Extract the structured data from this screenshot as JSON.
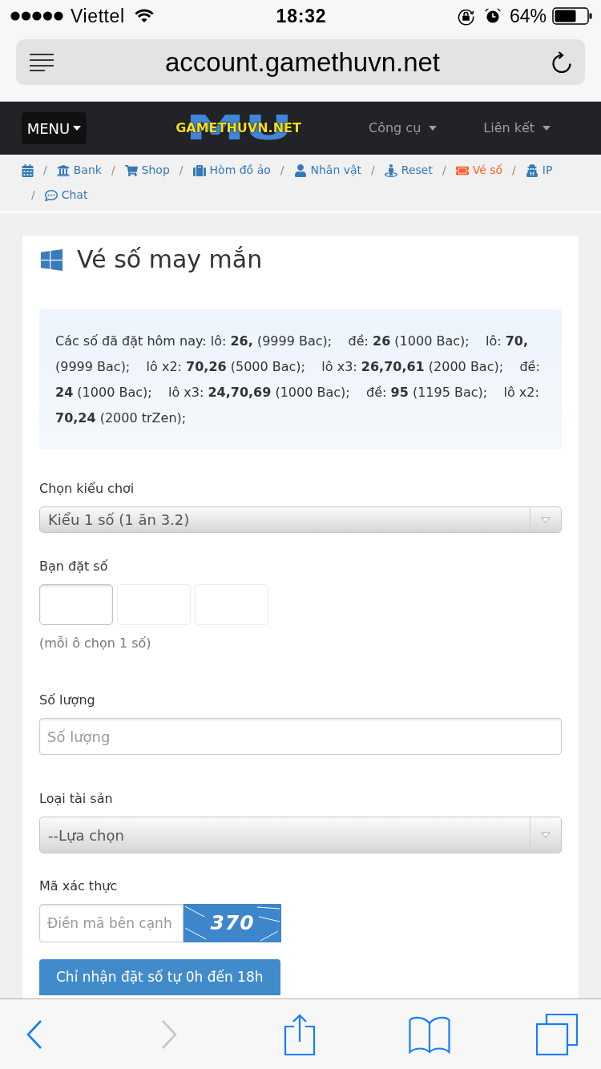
{
  "status_bar": {
    "carrier": "Viettel",
    "time": "18:32",
    "battery": "64%"
  },
  "address_bar": {
    "url": "account.gamethuvn.net"
  },
  "navbar": {
    "menu_button": "MENU",
    "logo": {
      "backdrop": "MU",
      "text": "GAMETHUVN.NET"
    },
    "links": [
      "Công cụ",
      "Liên kết"
    ]
  },
  "breadcrumb": [
    {
      "selected": false
    },
    {
      "separator": "/",
      "label": "Bank",
      "selected": false
    },
    {
      "separator": "/",
      "label": "Shop",
      "selected": false
    },
    {
      "separator": "/",
      "label": "Hòm đồ ảo",
      "selected": false
    },
    {
      "separator": "/",
      "label": "Nhân vật",
      "selected": false
    },
    {
      "separator": "/",
      "label": "Reset",
      "selected": false
    },
    {
      "separator": "/",
      "label": "Vé số",
      "selected": true
    },
    {
      "separator": "/",
      "label": "IP",
      "selected": false
    },
    {
      "separator": "/",
      "label": "Chat",
      "selected": false
    }
  ],
  "panel": {
    "title": "Vé số may mắn",
    "notice": "Các số đã đặt hôm nay: lô: **26,** (9999 Bac);    đề: **26** (1000 Bac);    lô: **70,** (9999 Bac);    lô x2: **70,26** (5000 Bac);    lô x3: **26,70,61** (2000 Bac);    đề: **24** (1000 Bac);    lô x3: **24,70,69** (1000 Bac);    đề: **95** (1195 Bac);    lô x2: **70,24** (2000 trZen);",
    "fields": [
      {
        "kind": "select",
        "label": "Chọn kiểu chơi",
        "value": "Kiểu 1 số (1 ăn 3.2)"
      },
      {
        "kind": "digits",
        "label": "Bạn đặt số",
        "boxes": [
          {
            "focused": true
          },
          {
            "focused": false
          },
          {
            "focused": false
          }
        ],
        "hint": "(mỗi ô chọn 1 số)"
      },
      {
        "kind": "input",
        "label": "Số lượng",
        "placeholder": "Số lượng"
      },
      {
        "kind": "select",
        "label": "Loại tài sản",
        "value": "--Lựa chọn"
      },
      {
        "kind": "captcha",
        "label": "Mã xác thực",
        "placeholder": "Điền mã bên cạnh",
        "code": "370"
      }
    ],
    "submit_button": "Chỉ nhận đặt số tự 0h đến 18h"
  },
  "toolbar": [
    {
      "disabled": false
    },
    {
      "disabled": true
    },
    {
      "disabled": false
    },
    {
      "disabled": false
    },
    {
      "disabled": false
    }
  ]
}
